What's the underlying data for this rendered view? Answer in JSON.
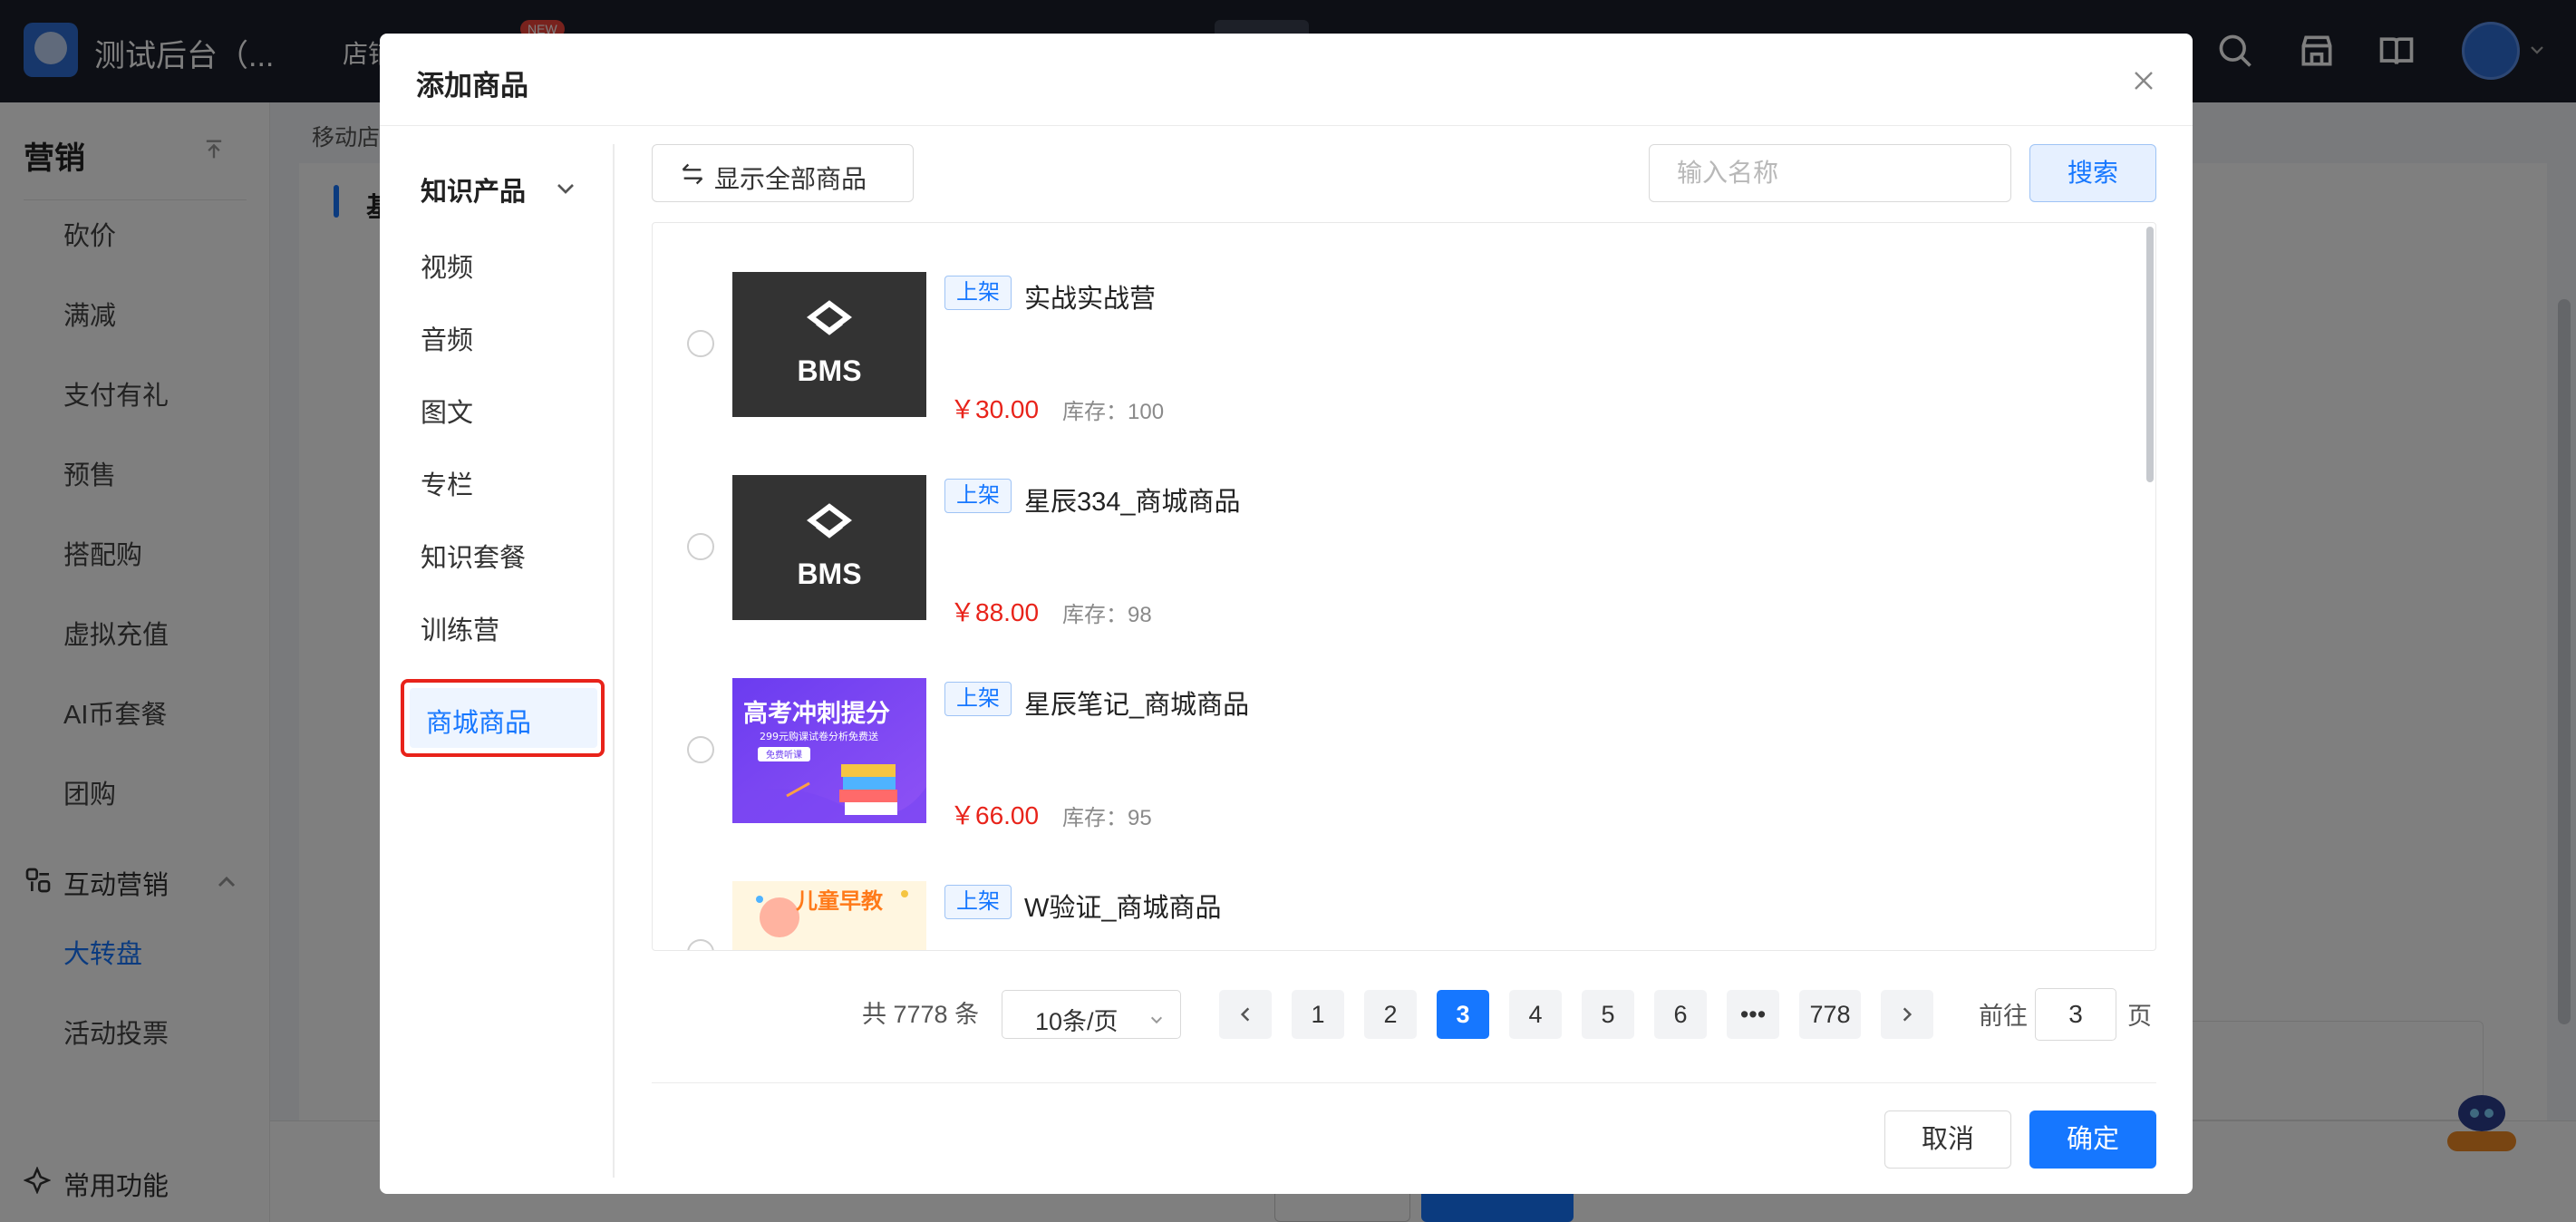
{
  "app": {
    "title": "测试后台（...",
    "topnav_item": "店铺",
    "new_badge": "NEW"
  },
  "sidebar": {
    "section_title": "营销",
    "items": [
      {
        "label": "砍价"
      },
      {
        "label": "满减"
      },
      {
        "label": "支付有礼"
      },
      {
        "label": "预售"
      },
      {
        "label": "搭配购"
      },
      {
        "label": "虚拟充值"
      },
      {
        "label": "AI币套餐"
      },
      {
        "label": "团购"
      }
    ],
    "group": {
      "label": "互动营销",
      "items": [
        {
          "label": "大转盘",
          "active": true
        },
        {
          "label": "活动投票",
          "active": false
        }
      ]
    },
    "bottom_label": "常用功能"
  },
  "content": {
    "breadcrumb": "移动店铺",
    "heading": "基"
  },
  "modal": {
    "title": "添加商品",
    "categories": {
      "header": "知识产品",
      "items": [
        "视频",
        "音频",
        "图文",
        "专栏",
        "知识套餐",
        "训练营"
      ],
      "active": "商城商品"
    },
    "show_all_label": "显示全部商品",
    "search": {
      "placeholder": "输入名称",
      "value": "",
      "button": "搜索"
    },
    "products": [
      {
        "status": "上架",
        "name": "实战实战营",
        "price": "￥30.00",
        "stock": "库存：100",
        "image": "bms-logo"
      },
      {
        "status": "上架",
        "name": "星辰334_商城商品",
        "price": "￥88.00",
        "stock": "库存：98",
        "image": "bms-logo"
      },
      {
        "status": "上架",
        "name": "星辰笔记_商城商品",
        "price": "￥66.00",
        "stock": "库存：95",
        "image": "exam-banner",
        "image_title": "高考冲刺提分",
        "image_subtitle": "299元购课试卷分析免费送",
        "image_tag": "免费听课"
      },
      {
        "status": "上架",
        "name": "W验证_商城商品",
        "price": "",
        "stock": "",
        "image": "kids-banner",
        "image_title": "儿童早教"
      }
    ],
    "pagination": {
      "total": "共 7778 条",
      "page_size": "10条/页",
      "pages": [
        "1",
        "2",
        "3",
        "4",
        "5",
        "6",
        "•••",
        "778"
      ],
      "current": "3",
      "goto_label": "前往",
      "goto_value": "3",
      "page_suffix": "页"
    },
    "footer": {
      "cancel": "取消",
      "confirm": "确定"
    }
  },
  "colors": {
    "primary": "#1677ff",
    "price_red": "#e8231a",
    "highlight_border": "#e8231a",
    "topbar": "#1b1f2a"
  }
}
